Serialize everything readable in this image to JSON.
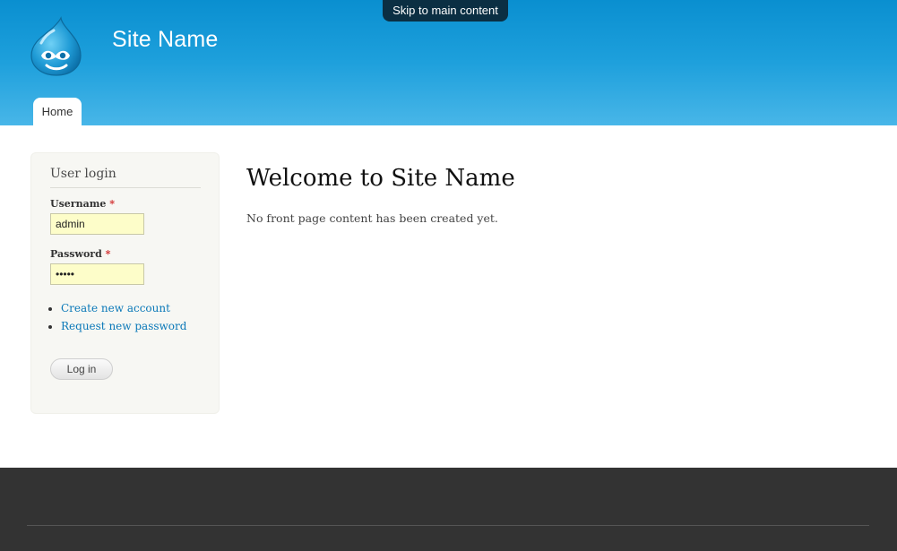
{
  "skip_link": "Skip to main content",
  "header": {
    "site_name": "Site Name",
    "logo_icon": "drupal-drop-logo-icon",
    "nav": [
      {
        "label": "Home"
      }
    ]
  },
  "sidebar": {
    "title": "User login",
    "username": {
      "label": "Username",
      "required_marker": "*",
      "value": "admin"
    },
    "password": {
      "label": "Password",
      "required_marker": "*",
      "value": "•••••"
    },
    "links": [
      {
        "label": "Create new account"
      },
      {
        "label": "Request new password"
      }
    ],
    "login_button": "Log in"
  },
  "main": {
    "title": "Welcome to Site Name",
    "body": "No front page content has been created yet."
  },
  "colors": {
    "header_top": "#0a8fd0",
    "header_bottom": "#48b6e8",
    "footer": "#333333",
    "link": "#0a78b8",
    "required": "#d12a2a"
  }
}
